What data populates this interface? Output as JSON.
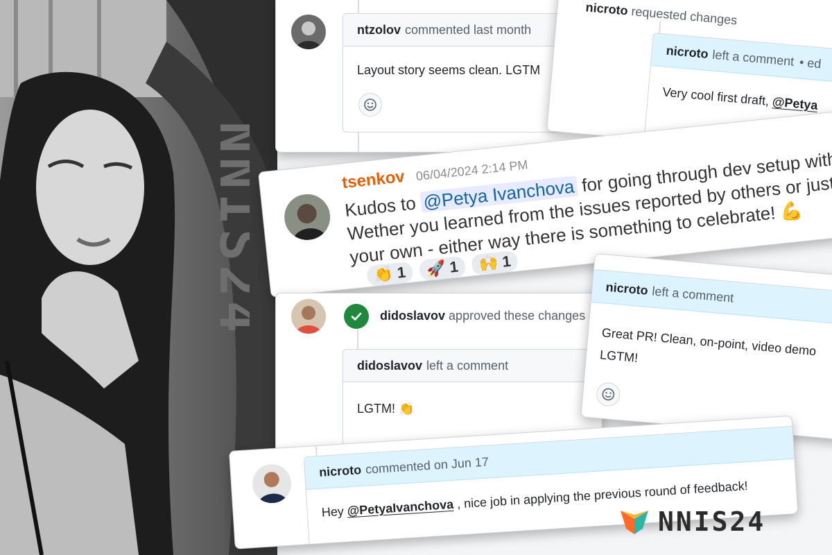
{
  "brand": {
    "name": "NNIS24",
    "vertical_text": "NNIS24",
    "colors": {
      "orange": "#ff6a2b",
      "teal": "#2db6a3"
    }
  },
  "cards": {
    "ntzolov": {
      "user": "ntzolov",
      "action": "commented last month",
      "body": "Layout story seems clean. LGTM"
    },
    "nicroto_draft": {
      "top_user": "nicroto",
      "top_action": "requested changes",
      "user": "nicroto",
      "action": "left a comment",
      "action_extra": "•  ed",
      "body_prefix": "Very cool first draft, ",
      "mention": "@Petya"
    },
    "tsenkov": {
      "user": "tsenkov",
      "timestamp": "06/04/2024 2:14 PM",
      "line1_prefix": "Kudos to ",
      "mention": "@Petya Ivanchova",
      "line1_suffix": " for going through dev setup with issues",
      "line2": "Wether you learned from the issues reported by others or just fixed",
      "line3_prefix": "your own - either way there is something to celebrate! ",
      "line3_emoji": "💪",
      "reactions": [
        {
          "emoji": "👏",
          "count": "1"
        },
        {
          "emoji": "🚀",
          "count": "1"
        },
        {
          "emoji": "🙌",
          "count": "1"
        }
      ]
    },
    "didoslavov": {
      "user": "didoslavov",
      "action": "approved these changes",
      "inner_user": "didoslavov",
      "inner_action": "left a comment",
      "body": "LGTM! 👏"
    },
    "nicroto_great": {
      "user": "nicroto",
      "action": "left a comment",
      "body_line1": "Great PR! Clean, on-point, video demo",
      "body_line2": "LGTM!"
    },
    "nicroto_jun": {
      "user": "nicroto",
      "action": "commented on Jun 17",
      "body_prefix": "Hey ",
      "mention": "@PetyaIvanchova",
      "body_suffix": " , nice job in applying the previous round of feedback!"
    }
  }
}
